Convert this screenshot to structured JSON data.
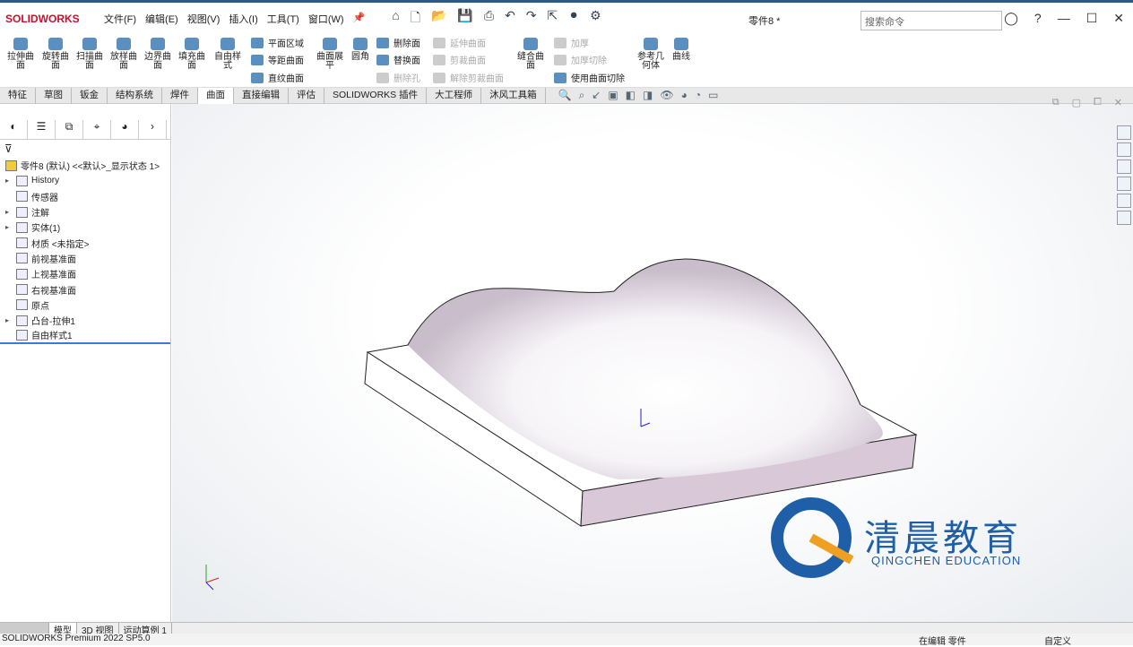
{
  "app": {
    "logo": "SOLIDWORKS",
    "title": "零件8 *",
    "search_placeholder": "搜索命令"
  },
  "menu": [
    "文件(F)",
    "编辑(E)",
    "视图(V)",
    "插入(I)",
    "工具(T)",
    "窗口(W)"
  ],
  "ribbon": {
    "big": [
      "拉伸曲面",
      "旋转曲面",
      "扫描曲面",
      "放样曲面",
      "边界曲面",
      "填充曲面",
      "自由样式",
      "曲面展平",
      "圆角",
      "缝合曲面",
      "参考几何体",
      "曲线"
    ],
    "small_enabled": [
      "平面区域",
      "等距曲面",
      "直纹曲面",
      "删除面",
      "替换面",
      "使用曲面切除"
    ],
    "small_disabled": [
      "删除孔",
      "延伸曲面",
      "剪裁曲面",
      "解除剪裁曲面",
      "加厚",
      "加厚切除"
    ]
  },
  "tabs": [
    "特征",
    "草图",
    "钣金",
    "结构系统",
    "焊件",
    "曲面",
    "直接编辑",
    "评估",
    "SOLIDWORKS 插件",
    "大工程师",
    "沐风工具箱"
  ],
  "active_tab": "曲面",
  "tree": {
    "root": "零件8 (默认) <<默认>_显示状态 1>",
    "items": [
      "History",
      "传感器",
      "注解",
      "实体(1)",
      "材质 <未指定>",
      "前视基准面",
      "上视基准面",
      "右视基准面",
      "原点",
      "凸台-拉伸1",
      "自由样式1"
    ]
  },
  "bottom_tabs": [
    "模型",
    "3D 视图",
    "运动算例 1"
  ],
  "status": {
    "left": "SOLIDWORKS Premium 2022 SP5.0",
    "mode": "在编辑 零件",
    "custom": "自定义"
  },
  "watermark": {
    "cn": "清晨教育",
    "en": "QINGCHEN EDUCATION"
  },
  "colors": {
    "accent": "#c8102e",
    "slab_side": "#d8c8d8"
  }
}
